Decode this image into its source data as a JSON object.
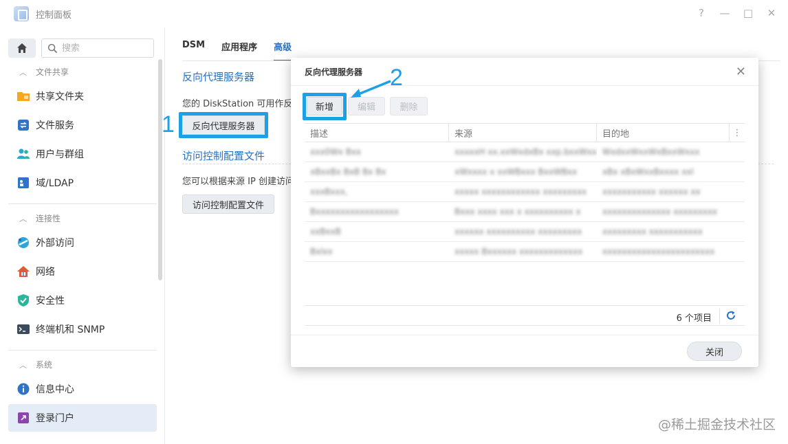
{
  "window": {
    "title": "控制面板",
    "controls": [
      "?",
      "—",
      "□",
      "✕"
    ]
  },
  "sidebar": {
    "search_placeholder": "搜索",
    "sections": [
      {
        "label": "文件共享",
        "items": [
          {
            "label": "共享文件夹",
            "icon": "folder-icon",
            "color": "#f5a623"
          },
          {
            "label": "文件服务",
            "icon": "file-service-icon",
            "color": "#2f74c9"
          },
          {
            "label": "用户与群组",
            "icon": "users-icon",
            "color": "#2aa6d9"
          },
          {
            "label": "域/LDAP",
            "icon": "ldap-icon",
            "color": "#2f74c9"
          }
        ]
      },
      {
        "label": "连接性",
        "items": [
          {
            "label": "外部访问",
            "icon": "external-access-icon",
            "color": "#2aa6d9"
          },
          {
            "label": "网络",
            "icon": "network-icon",
            "color": "#e05a3a"
          },
          {
            "label": "安全性",
            "icon": "shield-icon",
            "color": "#2bb59c"
          },
          {
            "label": "终端机和 SNMP",
            "icon": "terminal-icon",
            "color": "#3c4a5c"
          }
        ]
      },
      {
        "label": "系统",
        "items": [
          {
            "label": "信息中心",
            "icon": "info-icon",
            "color": "#2f74c9"
          },
          {
            "label": "登录门户",
            "icon": "login-portal-icon",
            "color": "#8e44ad",
            "active": true
          }
        ]
      }
    ]
  },
  "main": {
    "tabs": [
      {
        "label": "DSM"
      },
      {
        "label": "应用程序"
      },
      {
        "label": "高级",
        "active": true
      }
    ],
    "reverse_proxy": {
      "title": "反向代理服务器",
      "desc": "您的 DiskStation 可用作反",
      "button": "反向代理服务器"
    },
    "access_control": {
      "title": "访问控制配置文件",
      "desc": "您可以根据来源 IP 创建访问",
      "button": "访问控制配置文件"
    }
  },
  "annotations": {
    "step1": "1",
    "step2": "2",
    "color": "#1da1e6"
  },
  "modal": {
    "title": "反向代理服务器",
    "buttons": {
      "add": "新增",
      "edit": "编辑",
      "delete": "删除"
    },
    "columns": [
      "描述",
      "来源",
      "目的地"
    ],
    "rows": [
      [
        "xxx0Wx Bxx",
        "xxxxxH xx.xxWxdxBx xxp.bxxWxx",
        "WxdxxWxxWxBxxWxxx"
      ],
      [
        "xBxxBx BxB Bx Bx",
        "xWxxxx x xxWBxxx BxxWBxx",
        "xBx xBxWxxBxxxx xxl"
      ],
      [
        "xxxBxxx,",
        "xxxxx xxxxxxxxxxxx xxxxxxxxx",
        "xxxxxxxxxxx xxxxxx xx"
      ],
      [
        "Bxxxxxxxxxxxxxxxxx",
        "Bxxx xxxx xxx x xxxxxxxxxx x",
        "xxxxxxxxxxxxxx xxxxxxxxx"
      ],
      [
        "xxBxxB",
        "xxxxxx xxxxxxxxxx xxxxxxxxx",
        "xxxxxxxxx xxxxxxxxxxx"
      ],
      [
        "Bxlxx",
        "xxxxx Bxxxxxx xxxxxxxxxxxxx",
        "xxxxxxxxxxxxxxxxxxxxxxx"
      ]
    ],
    "count": "6 个项目",
    "close": "关闭"
  },
  "watermark": "@稀土掘金技术社区"
}
